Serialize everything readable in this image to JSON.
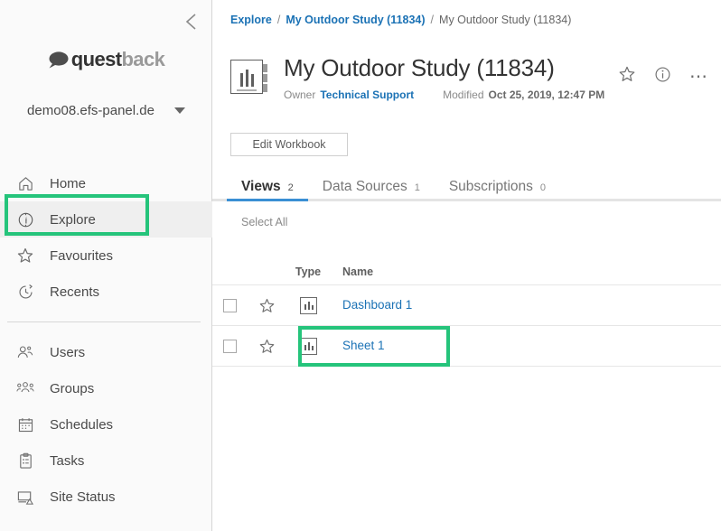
{
  "colors": {
    "accent_blue": "#1b72b5",
    "tab_underline": "#3a8fd4",
    "highlight_green": "#25c47b",
    "sidebar_bg": "#fafafa",
    "active_nav_bg": "#efefef"
  },
  "sidebar": {
    "collapse_icon": "chevron-left-icon",
    "logo": {
      "part1": "quest",
      "part2": "back",
      "bubble_icon": "speech-bubble-icon"
    },
    "site": {
      "name": "demo08.efs-panel.de",
      "caret_icon": "caret-down-icon"
    },
    "items": [
      {
        "label": "Home",
        "icon": "home-icon",
        "active": false
      },
      {
        "label": "Explore",
        "icon": "compass-icon",
        "active": true
      },
      {
        "label": "Favourites",
        "icon": "star-icon",
        "active": false
      },
      {
        "label": "Recents",
        "icon": "clock-icon",
        "active": false
      }
    ],
    "items2": [
      {
        "label": "Users",
        "icon": "users-icon"
      },
      {
        "label": "Groups",
        "icon": "groups-icon"
      },
      {
        "label": "Schedules",
        "icon": "calendar-icon"
      },
      {
        "label": "Tasks",
        "icon": "clipboard-icon"
      },
      {
        "label": "Site Status",
        "icon": "site-status-icon"
      }
    ]
  },
  "breadcrumb": {
    "root": "Explore",
    "sep": "/",
    "parent": "My Outdoor Study (11834)",
    "current": "My Outdoor Study (11834)"
  },
  "header": {
    "workbook_icon": "workbook-icon",
    "title": "My Outdoor Study (11834)",
    "owner_label": "Owner",
    "owner_name": "Technical Support",
    "modified_label": "Modified",
    "modified_value": "Oct 25, 2019, 12:47 PM",
    "actions": {
      "favorite_icon": "star-outline-icon",
      "info_icon": "info-circle-icon",
      "more_icon": "more-horizontal-icon"
    }
  },
  "toolbar": {
    "edit_workbook_label": "Edit Workbook"
  },
  "tabs": [
    {
      "label": "Views",
      "count": "2",
      "active": true
    },
    {
      "label": "Data Sources",
      "count": "1",
      "active": false
    },
    {
      "label": "Subscriptions",
      "count": "0",
      "active": false
    }
  ],
  "grid": {
    "select_all_label": "Select All",
    "columns": {
      "type": "Type",
      "name": "Name"
    },
    "rows": [
      {
        "name": "Dashboard 1",
        "type_icon": "view-chart-icon",
        "star_icon": "star-outline-icon",
        "checkbox": "unchecked",
        "highlighted": false
      },
      {
        "name": "Sheet 1",
        "type_icon": "view-chart-icon",
        "star_icon": "star-outline-icon",
        "checkbox": "unchecked",
        "highlighted": true
      }
    ]
  },
  "annotations": [
    {
      "target": "sidebar-item-explore",
      "color": "#25c47b"
    },
    {
      "target": "grid-row-sheet-1",
      "color": "#25c47b"
    }
  ]
}
